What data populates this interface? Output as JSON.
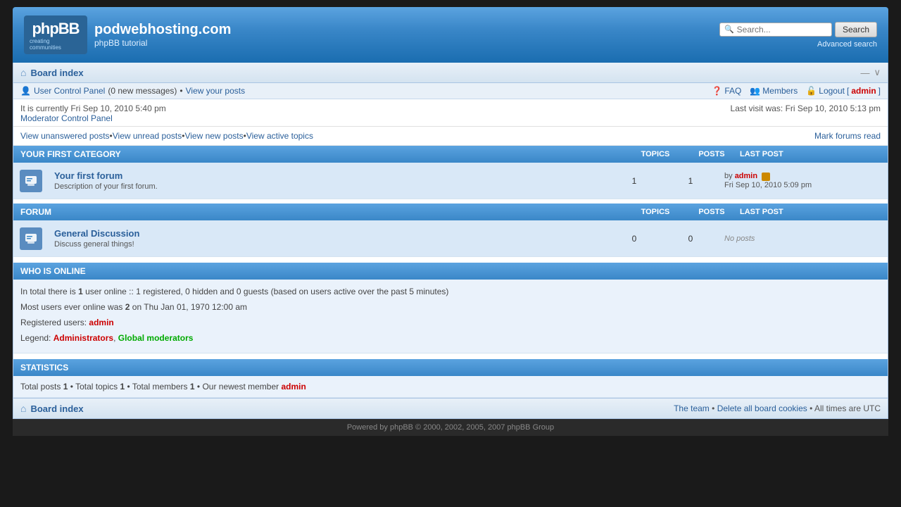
{
  "header": {
    "site_name": "podwebhosting.com",
    "site_tagline": "phpBB tutorial",
    "logo_text": "phpBB",
    "logo_sub": "creating communities",
    "search_placeholder": "Search...",
    "search_button": "Search",
    "advanced_search": "Advanced search"
  },
  "breadcrumb": {
    "label": "Board index",
    "icons": [
      "–",
      "–"
    ]
  },
  "user_nav": {
    "control_panel": "User Control Panel",
    "new_messages": "0",
    "new_messages_label": "new messages",
    "view_posts": "View your posts",
    "faq": "FAQ",
    "members": "Members",
    "logout": "Logout",
    "username": "admin"
  },
  "info_bar": {
    "current_time": "It is currently Fri Sep 10, 2010 5:40 pm",
    "moderator_panel": "Moderator Control Panel",
    "last_visit": "Last visit was: Fri Sep 10, 2010 5:13 pm"
  },
  "action_links": {
    "unanswered": "View unanswered posts",
    "unread": "View unread posts",
    "new_posts": "View new posts",
    "active_topics": "View active topics",
    "mark_read": "Mark forums read"
  },
  "first_category": {
    "title": "YOUR FIRST CATEGORY",
    "col_topics": "TOPICS",
    "col_posts": "POSTS",
    "col_lastpost": "LAST POST",
    "forums": [
      {
        "name": "Your first forum",
        "description": "Description of your first forum.",
        "topics": "1",
        "posts": "1",
        "last_post_by": "admin",
        "last_post_time": "Fri Sep 10, 2010 5:09 pm",
        "has_post": true
      }
    ]
  },
  "forum_section": {
    "title": "FORUM",
    "col_topics": "TOPICS",
    "col_posts": "POSTS",
    "col_lastpost": "LAST POST",
    "forums": [
      {
        "name": "General Discussion",
        "description": "Discuss general things!",
        "topics": "0",
        "posts": "0",
        "last_post": "No posts",
        "has_post": false
      }
    ]
  },
  "who_is_online": {
    "title": "WHO IS ONLINE",
    "online_text": "In total there is",
    "online_count": "1",
    "online_suffix": "user online :: 1 registered, 0 hidden and 0 guests (based on users active over the past 5 minutes)",
    "max_users_text": "Most users ever online was",
    "max_users": "2",
    "max_users_suffix": "on Thu Jan 01, 1970 12:00 am",
    "registered_label": "Registered users:",
    "registered_user": "admin",
    "legend_label": "Legend:",
    "administrators": "Administrators",
    "global_moderators": "Global moderators"
  },
  "statistics": {
    "title": "STATISTICS",
    "total_posts_label": "Total posts",
    "total_posts": "1",
    "total_topics_label": "Total topics",
    "total_topics": "1",
    "total_members_label": "Total members",
    "total_members": "1",
    "newest_member_label": "Our newest member",
    "newest_member": "admin"
  },
  "footer": {
    "board_index": "Board index",
    "the_team": "The team",
    "delete_cookies": "Delete all board cookies",
    "timezone": "All times are UTC"
  },
  "copyright": "Powered by phpBB © 2000, 2002, 2005, 2007 phpBB Group"
}
